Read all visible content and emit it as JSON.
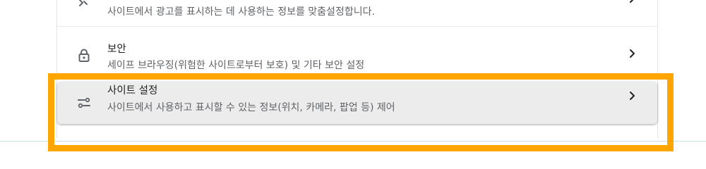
{
  "settings": {
    "ads_row": {
      "subtitle": "사이트에서 광고를 표시하는 데 사용하는 정보를 맞춤설정합니다.",
      "icon": "ads-icon"
    },
    "security_row": {
      "title": "보안",
      "subtitle": "세이프 브라우징(위험한 사이트로부터 보호) 및 기타 보안 설정",
      "icon": "lock-icon"
    },
    "site_settings_row": {
      "title": "사이트 설정",
      "subtitle": "사이트에서 사용하고 표시할 수 있는 정보(위치, 카메라, 팝업 등) 제어",
      "icon": "tune-icon"
    }
  },
  "annotation": {
    "highlight_color": "#FFA500"
  }
}
